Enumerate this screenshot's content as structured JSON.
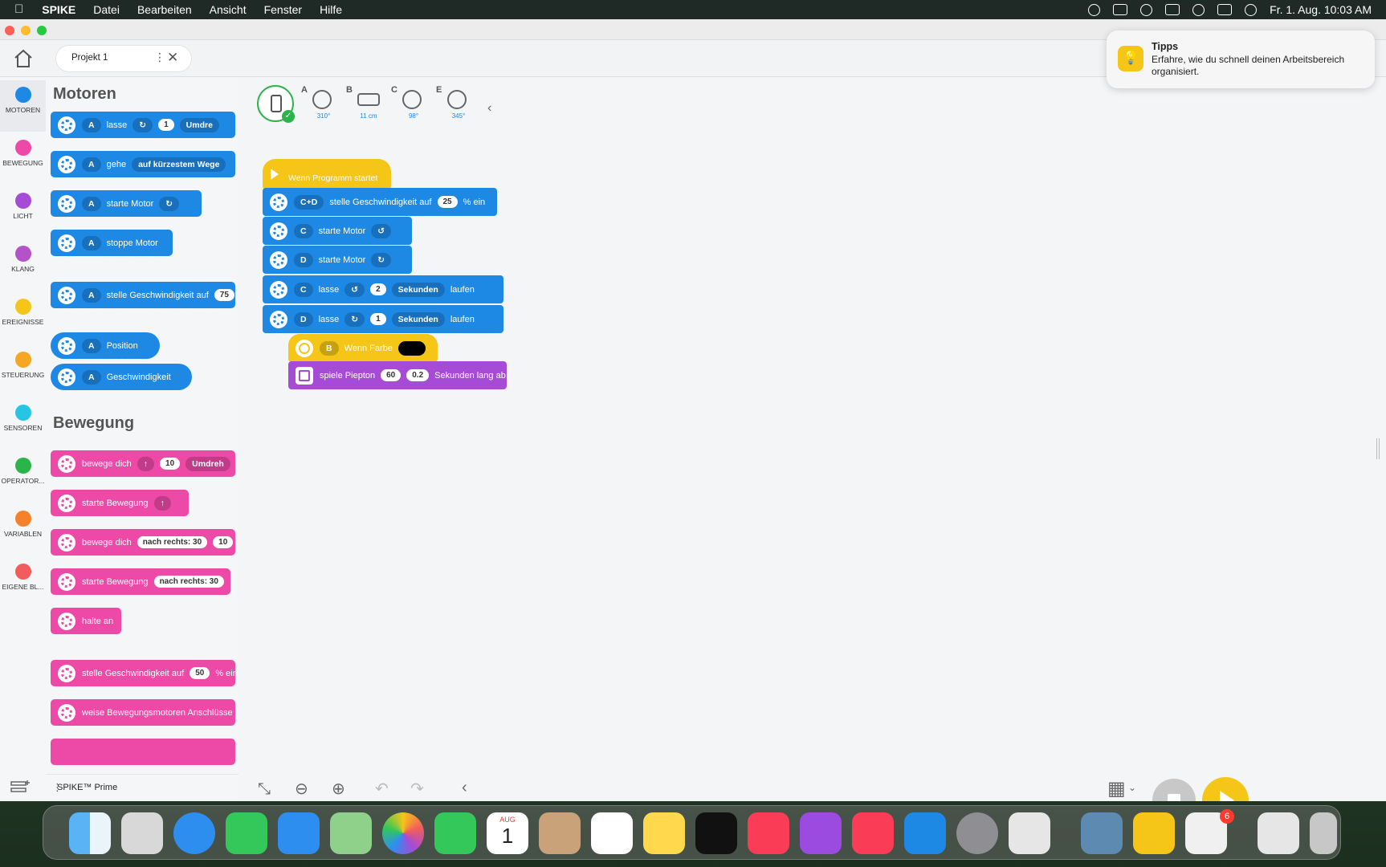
{
  "menubar": {
    "apple": "",
    "app": "SPIKE",
    "items": [
      "Datei",
      "Bearbeiten",
      "Ansicht",
      "Fenster",
      "Hilfe"
    ],
    "clock": "Fr. 1. Aug.  10:03 AM"
  },
  "tab": {
    "label": "Projekt 1",
    "menu": "⋮",
    "close": "✕"
  },
  "categories": [
    {
      "label": "MOTOREN",
      "color": "#1e88e5"
    },
    {
      "label": "BEWEGUNG",
      "color": "#ec4aa6"
    },
    {
      "label": "LICHT",
      "color": "#a64bd6"
    },
    {
      "label": "KLANG",
      "color": "#b452c9"
    },
    {
      "label": "EREIGNISSE",
      "color": "#f5c518"
    },
    {
      "label": "STEUERUNG",
      "color": "#f5a623"
    },
    {
      "label": "SENSOREN",
      "color": "#27c4e3"
    },
    {
      "label": "OPERATOR...",
      "color": "#2ab44a"
    },
    {
      "label": "VARIABLEN",
      "color": "#f5822a"
    },
    {
      "label": "EIGENE BL...",
      "color": "#f25c5c"
    }
  ],
  "palette": {
    "motoren_title": "Motoren",
    "bewegung_title": "Bewegung",
    "footer": "SPIKE™ Prime",
    "m1": {
      "port": "A",
      "text": "lasse",
      "dir": "↻",
      "val": "1",
      "unit": "Umdre"
    },
    "m2": {
      "port": "A",
      "text": "gehe",
      "opt": "auf kürzestem Wege"
    },
    "m3": {
      "port": "A",
      "text": "starte Motor",
      "dir": "↻"
    },
    "m4": {
      "port": "A",
      "text": "stoppe Motor"
    },
    "m5": {
      "port": "A",
      "text": "stelle Geschwindigkeit auf",
      "val": "75"
    },
    "m6": {
      "port": "A",
      "text": "Position"
    },
    "m7": {
      "port": "A",
      "text": "Geschwindigkeit"
    },
    "b1": {
      "text": "bewege dich",
      "dir": "↑",
      "val": "10",
      "unit": "Umdreh"
    },
    "b2": {
      "text": "starte Bewegung",
      "dir": "↑"
    },
    "b3": {
      "text": "bewege dich",
      "opt": "nach rechts: 30",
      "val": "10"
    },
    "b4": {
      "text": "starte Bewegung",
      "opt": "nach rechts: 30"
    },
    "b5": {
      "text": "halte an"
    },
    "b6": {
      "text": "stelle Geschwindigkeit auf",
      "val": "50",
      "unit": "% ein"
    },
    "b7": {
      "text": "weise Bewegungsmotoren Anschlüsse"
    }
  },
  "ports": [
    {
      "label": "A",
      "value": "310°"
    },
    {
      "label": "B",
      "value": "11 cm"
    },
    {
      "label": "C",
      "value": "98°"
    },
    {
      "label": "E",
      "value": "345°"
    }
  ],
  "script": {
    "hat": "Wenn Programm startet",
    "s1": {
      "port": "C+D",
      "text": "stelle Geschwindigkeit auf",
      "val": "25",
      "unit": "% ein"
    },
    "s2": {
      "port": "C",
      "text": "starte Motor",
      "dir": "↺"
    },
    "s3": {
      "port": "D",
      "text": "starte Motor",
      "dir": "↻"
    },
    "s4": {
      "port": "C",
      "text": "lasse",
      "dir": "↺",
      "val": "2",
      "unit": "Sekunden",
      "end": "laufen"
    },
    "s5": {
      "port": "D",
      "text": "lasse",
      "dir": "↻",
      "val": "1",
      "unit": "Sekunden",
      "end": "laufen"
    },
    "s6": {
      "port": "B",
      "text": "Wenn Farbe"
    },
    "s7": {
      "text": "spiele Piepton",
      "val": "60",
      "val2": "0.2",
      "unit": "Sekunden lang ab"
    }
  },
  "notification": {
    "title": "Tipps",
    "body": "Erfahre, wie du schnell deinen Arbeitsbereich organisiert."
  },
  "dock_badge": "6",
  "calendar": {
    "month": "AUG",
    "day": "1"
  }
}
